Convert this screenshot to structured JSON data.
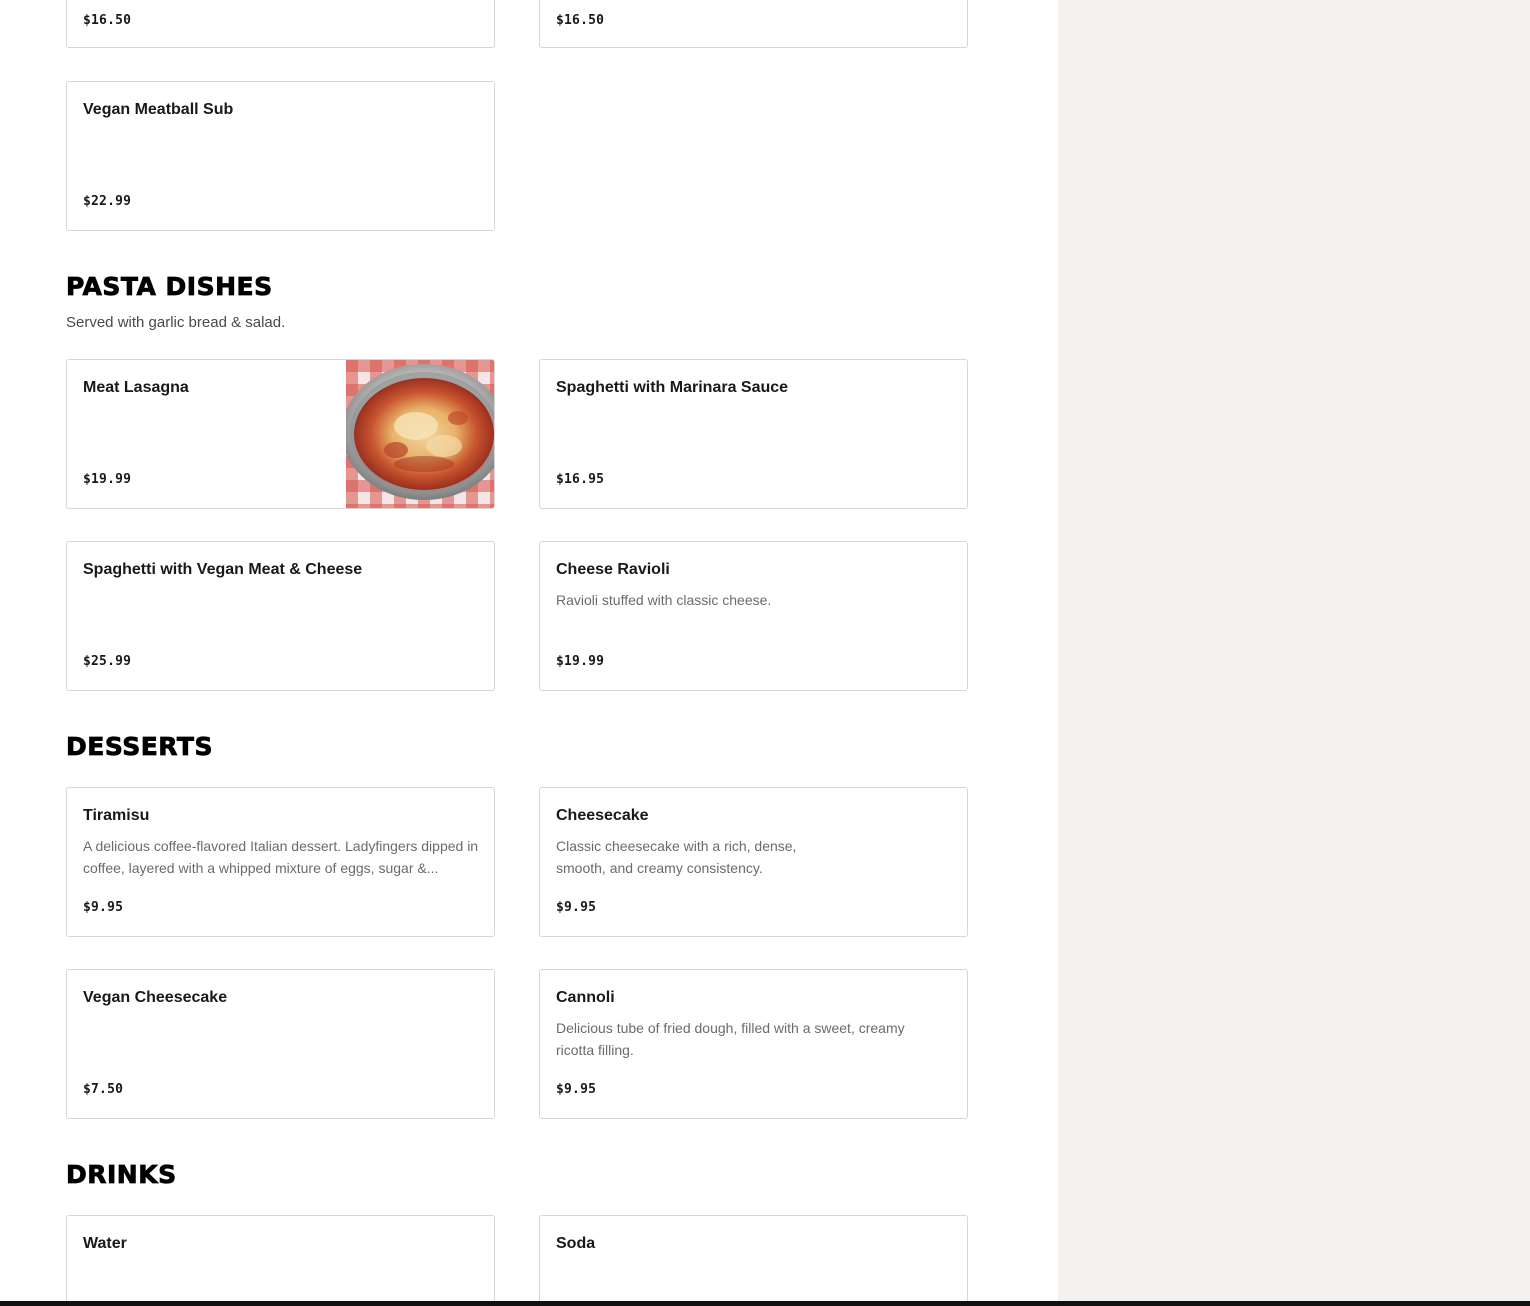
{
  "colors": {
    "page_bg": "#ffffff",
    "side_panel_bg": "#f3f2ef",
    "card_border": "#d6d6d6",
    "text_primary": "#191919",
    "text_muted": "#6b6b6b"
  },
  "previous_section": {
    "items": [
      {
        "price": "$16.50"
      },
      {
        "price": "$16.50"
      },
      {
        "name": "Vegan Meatball Sub",
        "price": "$22.99"
      }
    ]
  },
  "pasta": {
    "title": "PASTA DISHES",
    "subtitle": "Served with garlic bread & salad.",
    "items": [
      {
        "name": "Meat Lasagna",
        "price": "$19.99",
        "image_icon": "lasagna-photo"
      },
      {
        "name": "Spaghetti with Marinara Sauce",
        "price": "$16.95"
      },
      {
        "name": "Spaghetti with Vegan Meat & Cheese",
        "price": "$25.99"
      },
      {
        "name": "Cheese Ravioli",
        "description": "Ravioli stuffed with classic cheese.",
        "price": "$19.99"
      }
    ]
  },
  "desserts": {
    "title": "DESSERTS",
    "items": [
      {
        "name": "Tiramisu",
        "description": "A delicious coffee-flavored Italian dessert. Ladyfingers dipped in coffee, layered with a whipped mixture of eggs, sugar &...",
        "price": "$9.95"
      },
      {
        "name": "Cheesecake",
        "description": "Classic cheesecake with a rich, dense, smooth, and creamy consistency.",
        "price": "$9.95"
      },
      {
        "name": "Vegan Cheesecake",
        "price": "$7.50"
      },
      {
        "name": "Cannoli",
        "description": "Delicious tube of fried dough, filled with a sweet, creamy ricotta filling.",
        "price": "$9.95"
      }
    ]
  },
  "drinks": {
    "title": "DRINKS",
    "items": [
      {
        "name": "Water"
      },
      {
        "name": "Soda"
      }
    ]
  }
}
